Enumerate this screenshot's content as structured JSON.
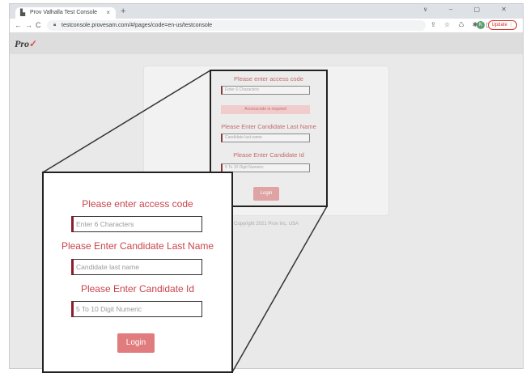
{
  "browser": {
    "tab_title": "Prov Valhalla Test Console",
    "tab_close": "×",
    "new_tab": "+",
    "window_controls": "∨ – ▢ ✕",
    "nav": {
      "back": "←",
      "forward": "→",
      "reload": "C"
    },
    "url": "testconsole.provesam.com/#/pages/code=en-us/testconsole",
    "toolbar_icons": "⇪ ☆ ♺ ✱ ◨",
    "avatar_initial": "K",
    "update_label": "Update ⋮"
  },
  "app": {
    "logo": "Pro",
    "logo_check": "✓",
    "copyright": "Copyright 2021 Prov Inc, USA"
  },
  "zoom_source": {
    "access_label": "Please enter access code",
    "access_placeholder": "Enter 6 Characters",
    "error": "Accesscode is required",
    "lastname_label": "Please Enter Candidate Last Name",
    "lastname_placeholder": "Candidate last name",
    "id_label": "Please Enter Candidate Id",
    "id_placeholder": "5 To 10 Digit Numeric",
    "login": "Login"
  },
  "zoom_panel": {
    "access_label": "Please enter access code",
    "access_placeholder": "Enter 6 Characters",
    "lastname_label": "Please Enter Candidate Last Name",
    "lastname_placeholder": "Candidate last name",
    "id_label": "Please Enter Candidate Id",
    "id_placeholder": "5 To 10 Digit Numeric",
    "login": "Login"
  },
  "colors": {
    "label_red": "#c9444a",
    "login_button": "#e07b7e",
    "input_accent": "#8b1e2b",
    "update_red": "#d93025"
  }
}
